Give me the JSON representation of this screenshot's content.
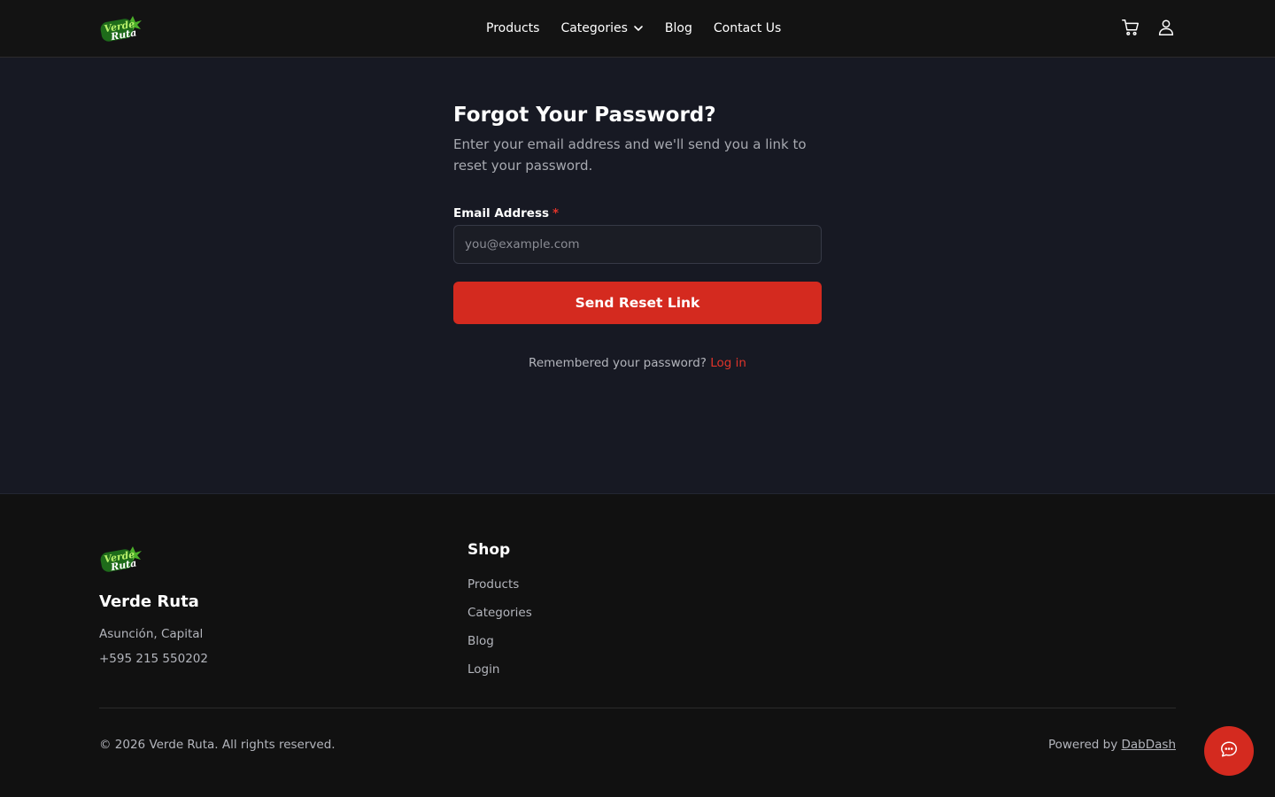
{
  "brand": {
    "name": "Verde Ruta",
    "logo_text_1": "Verde",
    "logo_text_2": "Ruta"
  },
  "nav": {
    "products": "Products",
    "categories": "Categories",
    "blog": "Blog",
    "contact": "Contact Us"
  },
  "header_icons": [
    "cart-icon",
    "user-icon"
  ],
  "form": {
    "title": "Forgot Your Password?",
    "subtitle": "Enter your email address and we'll send you a link to reset your password.",
    "email_label": "Email Address",
    "required_mark": "*",
    "email_placeholder": "you@example.com",
    "email_value": "",
    "submit_label": "Send Reset Link",
    "remember_text": "Remembered your password?",
    "login_link": "Log in"
  },
  "footer": {
    "brand": "Verde Ruta",
    "address": "Asunción, Capital",
    "phone": "+595 215 550202",
    "shop_title": "Shop",
    "shop_links": [
      "Products",
      "Categories",
      "Blog",
      "Login"
    ],
    "copyright": "© 2026 Verde Ruta. All rights reserved.",
    "powered_prefix": "Powered by",
    "powered_link": "DabDash"
  },
  "colors": {
    "accent": "#d42a1f",
    "background_main": "#171923",
    "background_footer": "#111111"
  }
}
